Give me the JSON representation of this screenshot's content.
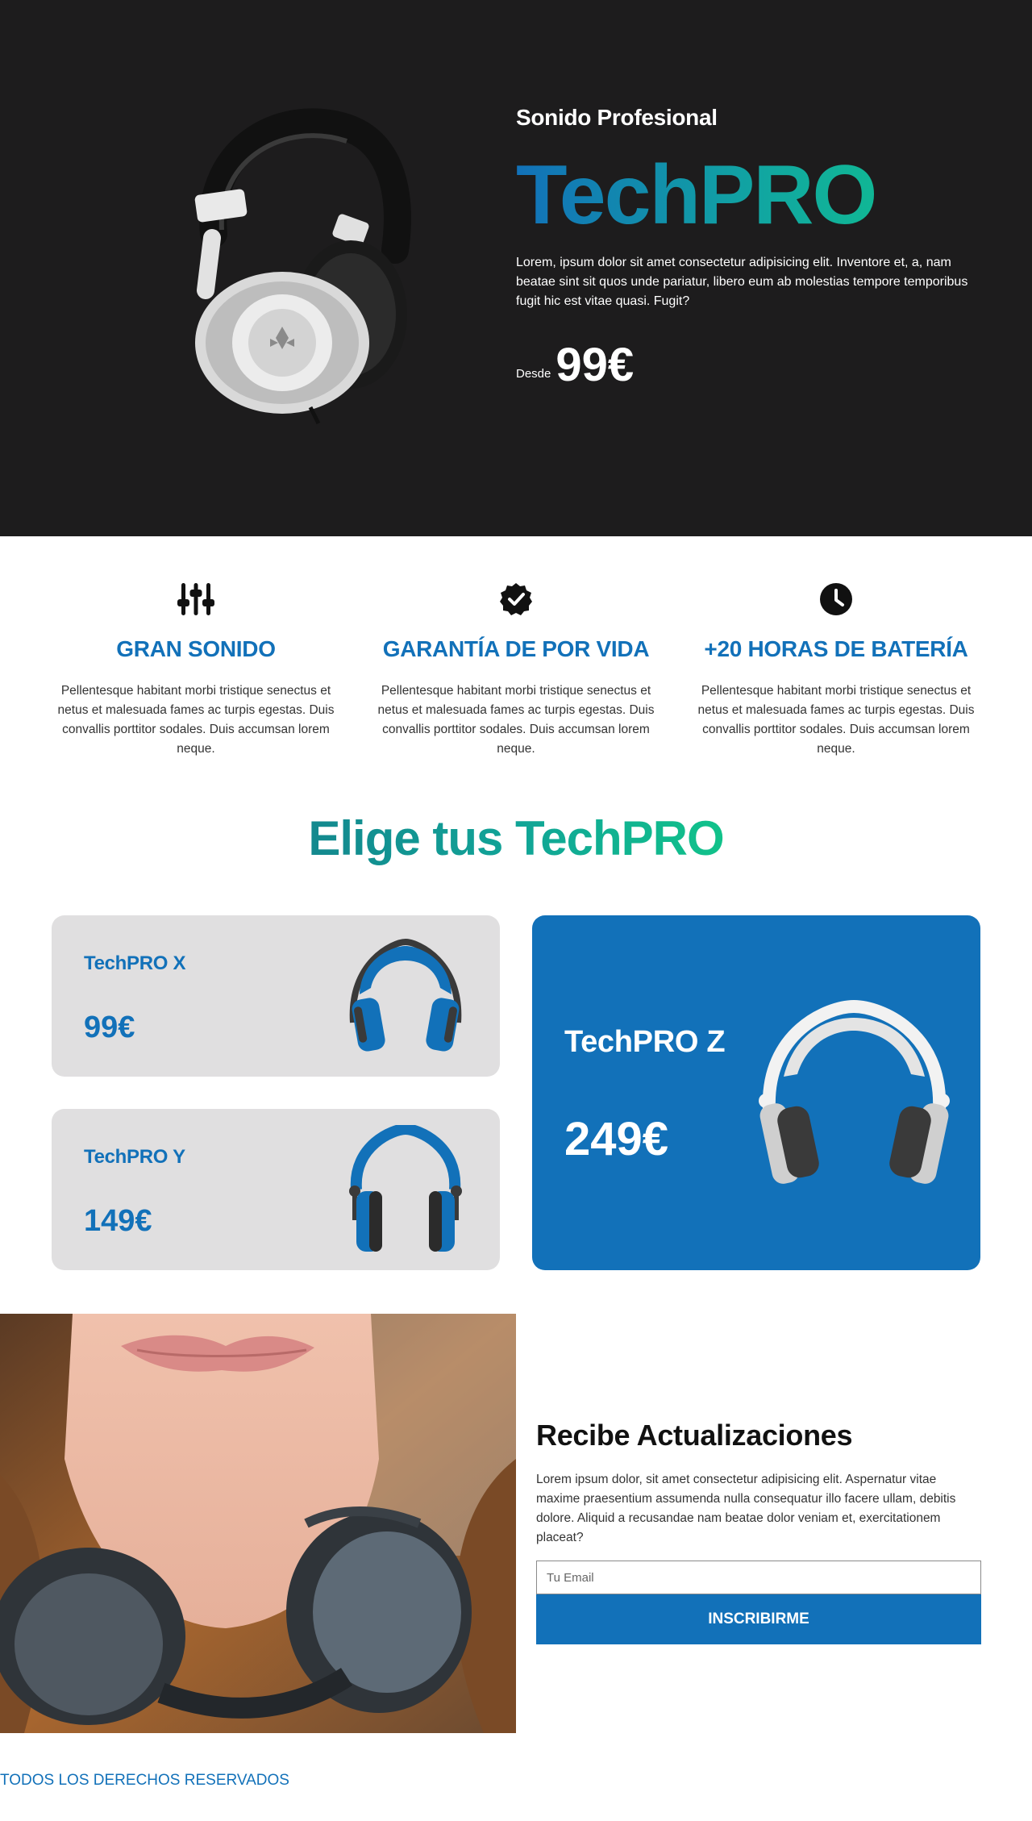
{
  "hero": {
    "eyebrow": "Sonido Profesional",
    "title": "TechPRO",
    "description": "Lorem, ipsum dolor sit amet consectetur adipisicing elit. Inventore et, a, nam beatae sint sit quos unde pariatur, libero eum ab molestias tempore temporibus fugit hic est vitae quasi. Fugit?",
    "price_prefix": "Desde",
    "price": "99€",
    "image_icon": "headphones-product-icon"
  },
  "features": [
    {
      "icon": "equalizer-sliders-icon",
      "title": "GRAN SONIDO",
      "text": "Pellentesque habitant morbi tristique senectus et netus et malesuada fames ac turpis egestas. Duis convallis porttitor sodales. Duis accumsan lorem neque."
    },
    {
      "icon": "check-badge-icon",
      "title": "GARANTÍA DE POR VIDA",
      "text": "Pellentesque habitant morbi tristique senectus et netus et malesuada fames ac turpis egestas. Duis convallis porttitor sodales. Duis accumsan lorem neque."
    },
    {
      "icon": "clock-icon",
      "title": "+20 HORAS DE BATERÍA",
      "text": "Pellentesque habitant morbi tristique senectus et netus et malesuada fames ac turpis egestas. Duis convallis porttitor sodales. Duis accumsan lorem neque."
    }
  ],
  "choose": {
    "title": "Elige tus TechPRO"
  },
  "products": [
    {
      "name": "TechPRO X",
      "price": "99€"
    },
    {
      "name": "TechPRO Y",
      "price": "149€"
    },
    {
      "name": "TechPRO Z",
      "price": "249€"
    }
  ],
  "newsletter": {
    "title": "Recibe Actualizaciones",
    "text": "Lorem ipsum dolor, sit amet consectetur adipisicing elit. Aspernatur vitae maxime praesentium assumenda nulla consequatur illo facere ullam, debitis dolore. Aliquid a recusandae nam beatae dolor veniam et, exercitationem placeat?",
    "email_placeholder": "Tu Email",
    "button_label": "INSCRIBIRME",
    "photo_icon": "woman-with-headphones-photo"
  },
  "footer": {
    "text": "TODOS LOS DERECHOS RESERVADOS"
  },
  "colors": {
    "primary_blue": "#1271b9",
    "teal_green": "#10c58a",
    "dark_bg": "#1d1c1d",
    "card_gray": "#e0dfe0"
  }
}
